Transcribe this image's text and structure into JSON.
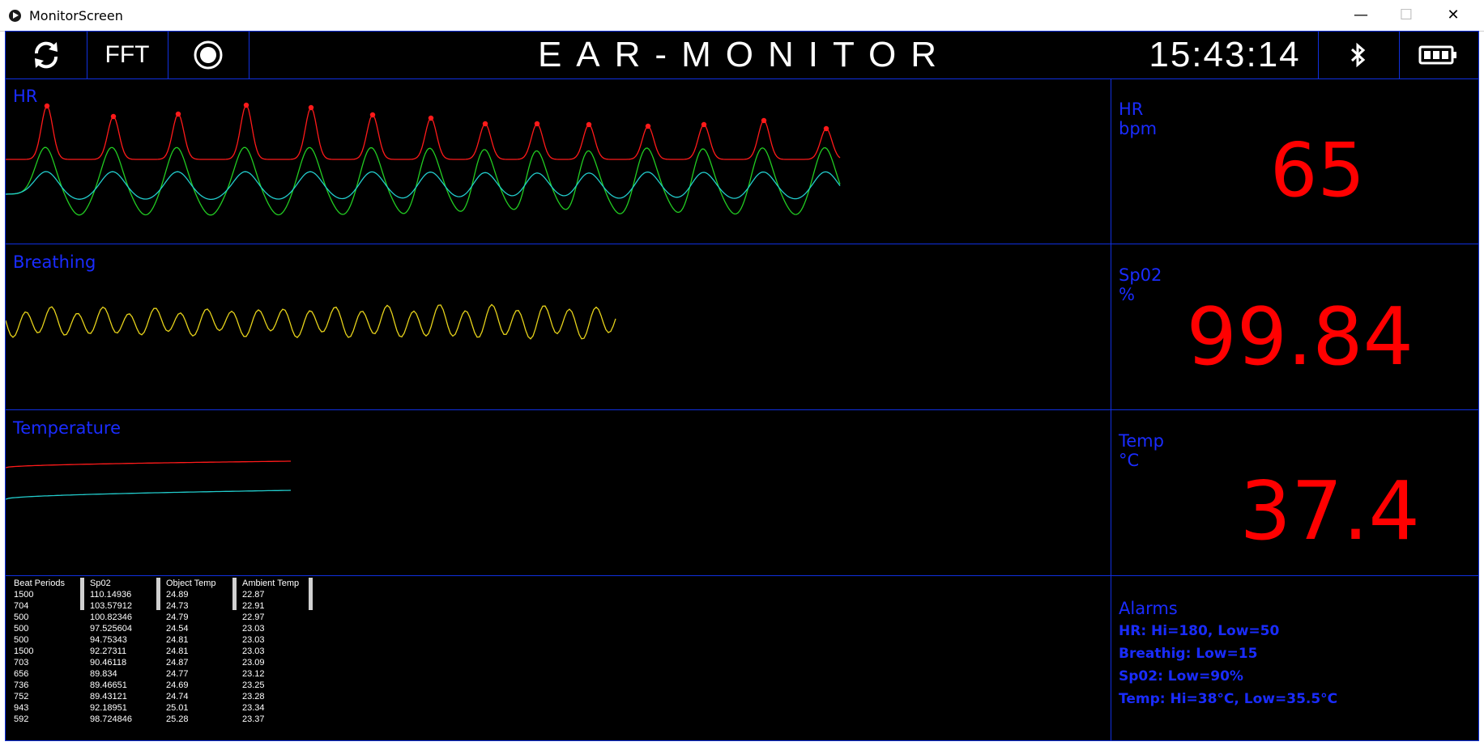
{
  "window": {
    "title": "MonitorScreen",
    "minimize": "—",
    "maximize": "☐",
    "close": "✕"
  },
  "toolbar": {
    "refresh_icon": "refresh-icon",
    "fft_label": "FFT",
    "record_icon": "record-icon",
    "title": "EAR-MONITOR",
    "clock": "15:43:14",
    "bluetooth_icon": "bluetooth-icon",
    "battery_icon": "battery-icon"
  },
  "colors": {
    "accent_blue": "#1a2cff",
    "value_red": "#ff0000",
    "hr_wave": "#ff1a1a",
    "green_wave": "#22cc22",
    "cyan_wave": "#22cccc",
    "breath_wave": "#e6d21a"
  },
  "panels": {
    "hr": {
      "wave_label": "HR",
      "side_label": "HR",
      "unit": "bpm",
      "value": "65"
    },
    "breathing": {
      "wave_label": "Breathing",
      "side_label": "Sp02",
      "unit": "%",
      "value": "99.84"
    },
    "temperature": {
      "wave_label": "Temperature",
      "side_label": "Temp",
      "unit": "°C",
      "value": "37.4"
    }
  },
  "table": {
    "headers": [
      "Beat Periods",
      "Sp02",
      "Object Temp",
      "Ambient Temp"
    ],
    "rows": [
      [
        "1500",
        "110.14936",
        "24.89",
        "22.87"
      ],
      [
        "704",
        "103.57912",
        "24.73",
        "22.91"
      ],
      [
        "500",
        "100.82346",
        "24.79",
        "22.97"
      ],
      [
        "500",
        "97.525604",
        "24.54",
        "23.03"
      ],
      [
        "500",
        "94.75343",
        "24.81",
        "23.03"
      ],
      [
        "1500",
        "92.27311",
        "24.81",
        "23.03"
      ],
      [
        "703",
        "90.46118",
        "24.87",
        "23.09"
      ],
      [
        "656",
        "89.834",
        "24.77",
        "23.12"
      ],
      [
        "736",
        "89.46651",
        "24.69",
        "23.25"
      ],
      [
        "752",
        "89.43121",
        "24.74",
        "23.28"
      ],
      [
        "943",
        "92.18951",
        "25.01",
        "23.34"
      ],
      [
        "592",
        "98.724846",
        "25.28",
        "23.37"
      ]
    ]
  },
  "alarms": {
    "title": "Alarms",
    "lines": [
      "HR: Hi=180, Low=50",
      "Breathig: Low=15",
      "Sp02: Low=90%",
      "Temp: Hi=38°C, Low=35.5°C"
    ]
  }
}
